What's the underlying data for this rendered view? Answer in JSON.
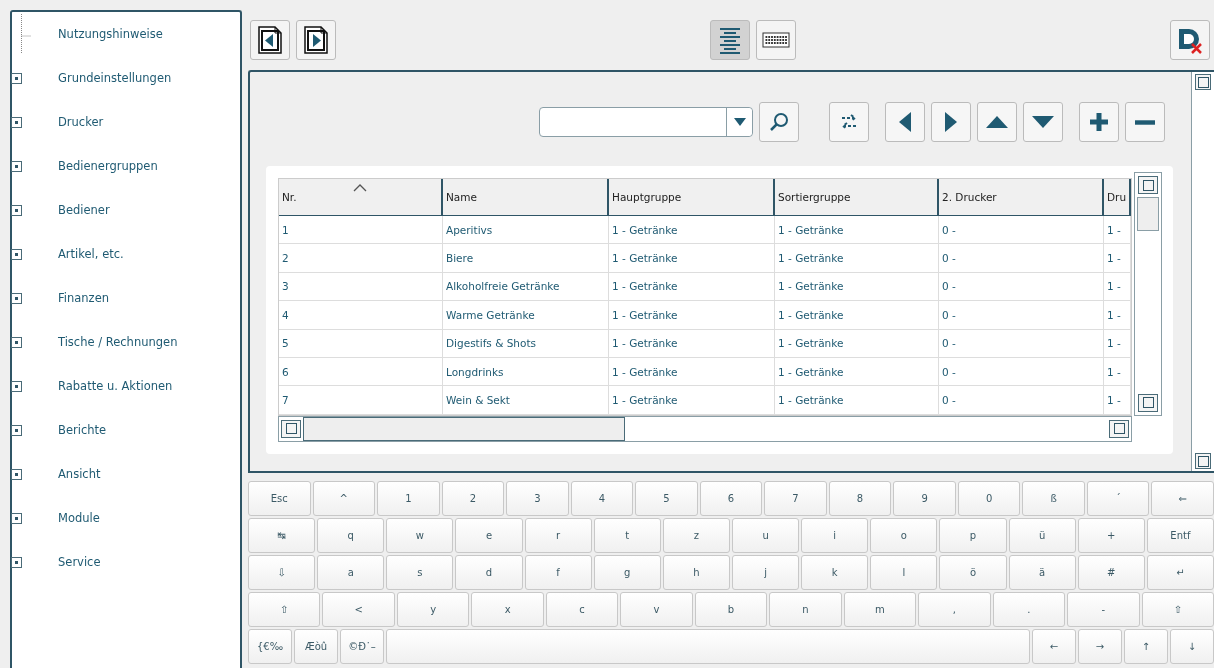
{
  "sidebar": {
    "items": [
      {
        "label": "Nutzungshinweise",
        "kind": "leaf"
      },
      {
        "label": "Grundeinstellungen",
        "kind": "folder",
        "expanded": false
      },
      {
        "label": "Drucker",
        "kind": "folder",
        "expanded": false
      },
      {
        "label": "Bedienergruppen",
        "kind": "folder",
        "expanded": false
      },
      {
        "label": "Bediener",
        "kind": "folder",
        "expanded": false
      },
      {
        "label": "Artikel, etc.",
        "kind": "folder",
        "expanded": false
      },
      {
        "label": "Finanzen",
        "kind": "folder",
        "expanded": false
      },
      {
        "label": "Tische / Rechnungen",
        "kind": "folder",
        "expanded": false
      },
      {
        "label": "Rabatte u. Aktionen",
        "kind": "folder",
        "expanded": false
      },
      {
        "label": "Berichte",
        "kind": "folder",
        "expanded": false
      },
      {
        "label": "Ansicht",
        "kind": "folder",
        "expanded": false
      },
      {
        "label": "Module",
        "kind": "folder",
        "expanded": false
      },
      {
        "label": "Service",
        "kind": "folder",
        "expanded": false
      }
    ]
  },
  "toolbar": {
    "view_modes": [
      {
        "kind": "list",
        "selected": true
      },
      {
        "kind": "keyboard",
        "selected": false
      }
    ]
  },
  "table": {
    "columns": [
      {
        "label": "Nr.",
        "sorted": true
      },
      {
        "label": "Name",
        "sorted": false
      },
      {
        "label": "Hauptgruppe",
        "sorted": false
      },
      {
        "label": "Sortiergruppe",
        "sorted": false
      },
      {
        "label": "2. Drucker",
        "sorted": false
      },
      {
        "label": "Dru",
        "sorted": false
      }
    ],
    "rows": [
      [
        "1",
        "Aperitivs",
        "1 - Getränke",
        "1 - Getränke",
        "0 -",
        "1 -"
      ],
      [
        "2",
        "Biere",
        "1 - Getränke",
        "1 - Getränke",
        "0 -",
        "1 -"
      ],
      [
        "3",
        "Alkoholfreie Getränke",
        "1 - Getränke",
        "1 - Getränke",
        "0 -",
        "1 -"
      ],
      [
        "4",
        "Warme Getränke",
        "1 - Getränke",
        "1 - Getränke",
        "0 -",
        "1 -"
      ],
      [
        "5",
        "Digestifs &  Shots",
        "1 - Getränke",
        "1 - Getränke",
        "0 -",
        "1 -"
      ],
      [
        "6",
        "Longdrinks",
        "1 - Getränke",
        "1 - Getränke",
        "0 -",
        "1 -"
      ],
      [
        "7",
        "Wein & Sekt",
        "1 - Getränke",
        "1 - Getränke",
        "0 -",
        "1 -"
      ]
    ]
  },
  "keyboard": {
    "rows": [
      {
        "keys": [
          {
            "label": "Esc"
          },
          {
            "label": "^"
          },
          {
            "label": "1"
          },
          {
            "label": "2"
          },
          {
            "label": "3"
          },
          {
            "label": "4"
          },
          {
            "label": "5"
          },
          {
            "label": "6"
          },
          {
            "label": "7"
          },
          {
            "label": "8"
          },
          {
            "label": "9"
          },
          {
            "label": "0"
          },
          {
            "label": "ß"
          },
          {
            "label": "´"
          },
          {
            "label": "⇐"
          }
        ]
      },
      {
        "keys": [
          {
            "label": "↹"
          },
          {
            "label": "q"
          },
          {
            "label": "w"
          },
          {
            "label": "e"
          },
          {
            "label": "r"
          },
          {
            "label": "t"
          },
          {
            "label": "z"
          },
          {
            "label": "u"
          },
          {
            "label": "i"
          },
          {
            "label": "o"
          },
          {
            "label": "p"
          },
          {
            "label": "ü"
          },
          {
            "label": "+"
          },
          {
            "label": "Entf"
          }
        ]
      },
      {
        "keys": [
          {
            "label": "⇩"
          },
          {
            "label": "a"
          },
          {
            "label": "s"
          },
          {
            "label": "d"
          },
          {
            "label": "f"
          },
          {
            "label": "g"
          },
          {
            "label": "h"
          },
          {
            "label": "j"
          },
          {
            "label": "k"
          },
          {
            "label": "l"
          },
          {
            "label": "ö"
          },
          {
            "label": "ä"
          },
          {
            "label": "#"
          },
          {
            "label": "↵"
          }
        ]
      },
      {
        "keys": [
          {
            "label": "⇧"
          },
          {
            "label": "<"
          },
          {
            "label": "y"
          },
          {
            "label": "x"
          },
          {
            "label": "c"
          },
          {
            "label": "v"
          },
          {
            "label": "b"
          },
          {
            "label": "n"
          },
          {
            "label": "m"
          },
          {
            "label": ","
          },
          {
            "label": "."
          },
          {
            "label": "-"
          },
          {
            "label": "⇧"
          }
        ]
      },
      {
        "keys": [
          {
            "label": "{€‰",
            "kind": "small"
          },
          {
            "label": "Æòû",
            "kind": "small"
          },
          {
            "label": "©Ð˙–",
            "kind": "small"
          },
          {
            "kind": "space"
          },
          {
            "label": "←",
            "kind": "small"
          },
          {
            "label": "→",
            "kind": "small"
          },
          {
            "label": "↑",
            "kind": "small"
          },
          {
            "label": "↓",
            "kind": "small"
          }
        ]
      }
    ]
  }
}
